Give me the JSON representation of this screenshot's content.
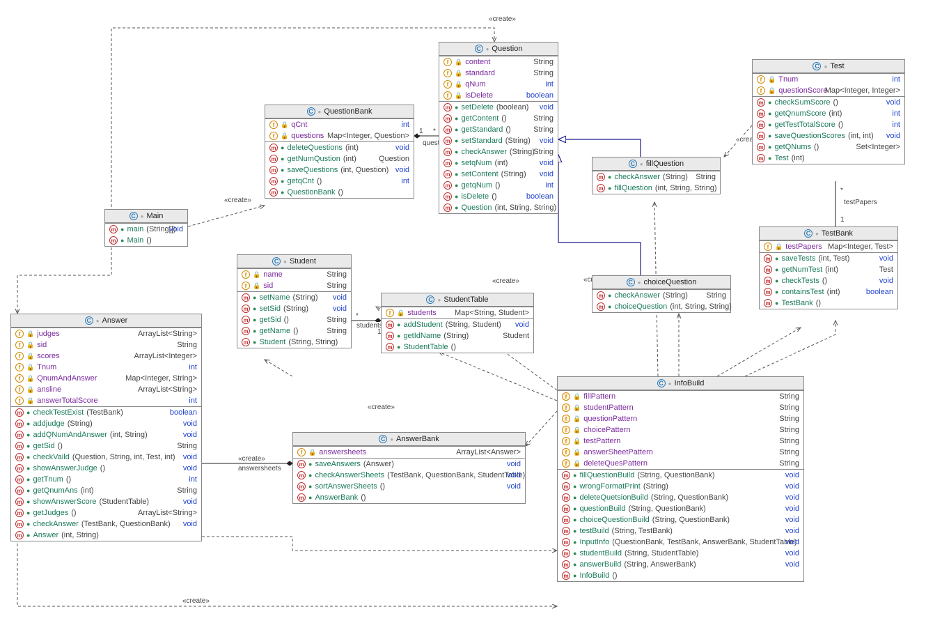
{
  "classes": {
    "Question": {
      "title": "Question",
      "fields": [
        {
          "badge": "f",
          "vis": "lock",
          "name": "content",
          "type": "String",
          "typeColor": "plain"
        },
        {
          "badge": "f",
          "vis": "lock",
          "name": "standard",
          "type": "String",
          "typeColor": "plain"
        },
        {
          "badge": "f",
          "vis": "lock",
          "name": "qNum",
          "type": "int",
          "typeColor": "blue"
        },
        {
          "badge": "f",
          "vis": "lock",
          "name": "isDelete",
          "type": "boolean",
          "typeColor": "blue"
        }
      ],
      "methods": [
        {
          "badge": "m",
          "vis": "green",
          "name": "setDelete",
          "params": "(boolean)",
          "type": "void",
          "typeColor": "blue"
        },
        {
          "badge": "m",
          "vis": "green",
          "name": "getContent",
          "params": "()",
          "type": "String",
          "typeColor": "plain"
        },
        {
          "badge": "m",
          "vis": "green",
          "name": "getStandard",
          "params": "()",
          "type": "String",
          "typeColor": "plain"
        },
        {
          "badge": "m",
          "vis": "green",
          "name": "setStandard",
          "params": "(String)",
          "type": "void",
          "typeColor": "blue"
        },
        {
          "badge": "m",
          "vis": "green",
          "name": "checkAnswer",
          "params": "(String)",
          "type": "String",
          "typeColor": "plain"
        },
        {
          "badge": "m",
          "vis": "green",
          "name": "setqNum",
          "params": "(int)",
          "type": "void",
          "typeColor": "blue"
        },
        {
          "badge": "m",
          "vis": "green",
          "name": "setContent",
          "params": "(String)",
          "type": "void",
          "typeColor": "blue"
        },
        {
          "badge": "m",
          "vis": "green",
          "name": "getqNum",
          "params": "()",
          "type": "int",
          "typeColor": "blue"
        },
        {
          "badge": "m",
          "vis": "green",
          "name": "isDelete",
          "params": "()",
          "type": "boolean",
          "typeColor": "blue"
        },
        {
          "badge": "m",
          "vis": "green",
          "name": "Question",
          "params": "(int, String, String)",
          "type": "",
          "typeColor": ""
        }
      ]
    },
    "Test": {
      "title": "Test",
      "fields": [
        {
          "badge": "f",
          "vis": "lock",
          "name": "Tnum",
          "type": "int",
          "typeColor": "blue"
        },
        {
          "badge": "f",
          "vis": "lock",
          "name": "questionScore",
          "type": "Map<Integer, Integer>",
          "typeColor": "plain"
        }
      ],
      "methods": [
        {
          "badge": "m",
          "vis": "green",
          "name": "checkSumScore",
          "params": "()",
          "type": "void",
          "typeColor": "blue"
        },
        {
          "badge": "m",
          "vis": "green",
          "name": "getQnumScore",
          "params": "(int)",
          "type": "int",
          "typeColor": "blue"
        },
        {
          "badge": "m",
          "vis": "green",
          "name": "getTestTotalScore",
          "params": "()",
          "type": "int",
          "typeColor": "blue"
        },
        {
          "badge": "m",
          "vis": "green",
          "name": "saveQuestionScores",
          "params": "(int, int)",
          "type": "void",
          "typeColor": "blue"
        },
        {
          "badge": "m",
          "vis": "green",
          "name": "getQNums",
          "params": "()",
          "type": "Set<Integer>",
          "typeColor": "plain"
        },
        {
          "badge": "m",
          "vis": "green",
          "name": "Test",
          "params": "(int)",
          "type": "",
          "typeColor": ""
        }
      ]
    },
    "QuestionBank": {
      "title": "QuestionBank",
      "fields": [
        {
          "badge": "f",
          "vis": "lock",
          "name": "qCnt",
          "type": "int",
          "typeColor": "blue"
        },
        {
          "badge": "f",
          "vis": "lock",
          "name": "questions",
          "type": "Map<Integer, Question>",
          "typeColor": "plain"
        }
      ],
      "methods": [
        {
          "badge": "m",
          "vis": "green",
          "name": "deleteQuestions",
          "params": "(int)",
          "type": "void",
          "typeColor": "blue"
        },
        {
          "badge": "m",
          "vis": "green",
          "name": "getNumQustion",
          "params": "(int)",
          "type": "Question",
          "typeColor": "plain"
        },
        {
          "badge": "m",
          "vis": "green",
          "name": "saveQuestions",
          "params": "(int, Question)",
          "type": "void",
          "typeColor": "blue"
        },
        {
          "badge": "m",
          "vis": "green",
          "name": "getqCnt",
          "params": "()",
          "type": "int",
          "typeColor": "blue"
        },
        {
          "badge": "m",
          "vis": "green",
          "name": "QuestionBank",
          "params": "()",
          "type": "",
          "typeColor": ""
        }
      ]
    },
    "fillQuestion": {
      "title": "fillQuestion",
      "fields": [],
      "methods": [
        {
          "badge": "m",
          "vis": "green",
          "name": "checkAnswer",
          "params": "(String)",
          "type": "String",
          "typeColor": "plain"
        },
        {
          "badge": "m",
          "vis": "green",
          "name": "fillQuestion",
          "params": "(int, String, String)",
          "type": "",
          "typeColor": ""
        }
      ]
    },
    "choiceQuestion": {
      "title": "choiceQuestion",
      "fields": [],
      "methods": [
        {
          "badge": "m",
          "vis": "green",
          "name": "checkAnswer",
          "params": "(String)",
          "type": "String",
          "typeColor": "plain"
        },
        {
          "badge": "m",
          "vis": "green",
          "name": "choiceQuestion",
          "params": "(int, String, String)",
          "type": "",
          "typeColor": ""
        }
      ]
    },
    "TestBank": {
      "title": "TestBank",
      "fields": [
        {
          "badge": "f",
          "vis": "lock",
          "name": "testPapers",
          "type": "Map<Integer, Test>",
          "typeColor": "plain"
        }
      ],
      "methods": [
        {
          "badge": "m",
          "vis": "green",
          "name": "saveTests",
          "params": "(int, Test)",
          "type": "void",
          "typeColor": "blue"
        },
        {
          "badge": "m",
          "vis": "green",
          "name": "getNumTest",
          "params": "(int)",
          "type": "Test",
          "typeColor": "plain"
        },
        {
          "badge": "m",
          "vis": "green",
          "name": "checkTests",
          "params": "()",
          "type": "void",
          "typeColor": "blue"
        },
        {
          "badge": "m",
          "vis": "green",
          "name": "containsTest",
          "params": "(int)",
          "type": "boolean",
          "typeColor": "blue"
        },
        {
          "badge": "m",
          "vis": "green",
          "name": "TestBank",
          "params": "()",
          "type": "",
          "typeColor": ""
        }
      ]
    },
    "Main": {
      "title": "Main",
      "fields": [],
      "methods": [
        {
          "badge": "m",
          "vis": "green",
          "name": "main",
          "params": "(String[])",
          "type": "void",
          "typeColor": "blue",
          "static": true
        },
        {
          "badge": "m",
          "vis": "green",
          "name": "Main",
          "params": "()",
          "type": "",
          "typeColor": ""
        }
      ]
    },
    "Student": {
      "title": "Student",
      "fields": [
        {
          "badge": "f",
          "vis": "lock",
          "name": "name",
          "type": "String",
          "typeColor": "plain"
        },
        {
          "badge": "f",
          "vis": "lock",
          "name": "sid",
          "type": "String",
          "typeColor": "plain"
        }
      ],
      "methods": [
        {
          "badge": "m",
          "vis": "green",
          "name": "setName",
          "params": "(String)",
          "type": "void",
          "typeColor": "blue"
        },
        {
          "badge": "m",
          "vis": "green",
          "name": "setSid",
          "params": "(String)",
          "type": "void",
          "typeColor": "blue"
        },
        {
          "badge": "m",
          "vis": "green",
          "name": "getSid",
          "params": "()",
          "type": "String",
          "typeColor": "plain"
        },
        {
          "badge": "m",
          "vis": "green",
          "name": "getName",
          "params": "()",
          "type": "String",
          "typeColor": "plain"
        },
        {
          "badge": "m",
          "vis": "green",
          "name": "Student",
          "params": "(String, String)",
          "type": "",
          "typeColor": ""
        }
      ]
    },
    "StudentTable": {
      "title": "StudentTable",
      "fields": [
        {
          "badge": "f",
          "vis": "lock",
          "name": "students",
          "type": "Map<String, Student>",
          "typeColor": "plain"
        }
      ],
      "methods": [
        {
          "badge": "m",
          "vis": "green",
          "name": "addStudent",
          "params": "(String, Student)",
          "type": "void",
          "typeColor": "blue"
        },
        {
          "badge": "m",
          "vis": "green",
          "name": "getIdName",
          "params": "(String)",
          "type": "Student",
          "typeColor": "plain"
        },
        {
          "badge": "m",
          "vis": "green",
          "name": "StudentTable",
          "params": "()",
          "type": "",
          "typeColor": ""
        }
      ]
    },
    "Answer": {
      "title": "Answer",
      "fields": [
        {
          "badge": "f",
          "vis": "lock",
          "name": "judges",
          "type": "ArrayList<String>",
          "typeColor": "plain"
        },
        {
          "badge": "f",
          "vis": "lock",
          "name": "sid",
          "type": "String",
          "typeColor": "plain"
        },
        {
          "badge": "f",
          "vis": "lock",
          "name": "scores",
          "type": "ArrayList<Integer>",
          "typeColor": "plain"
        },
        {
          "badge": "f",
          "vis": "lock",
          "name": "Tnum",
          "type": "int",
          "typeColor": "blue"
        },
        {
          "badge": "f",
          "vis": "lock",
          "name": "QnumAndAnswer",
          "type": "Map<Integer, String>",
          "typeColor": "plain"
        },
        {
          "badge": "f",
          "vis": "lock",
          "name": "ansline",
          "type": "ArrayList<String>",
          "typeColor": "plain"
        },
        {
          "badge": "f",
          "vis": "lock",
          "name": "answerTotalScore",
          "type": "int",
          "typeColor": "blue"
        }
      ],
      "methods": [
        {
          "badge": "m",
          "vis": "green",
          "name": "checkTestExist",
          "params": "(TestBank)",
          "type": "boolean",
          "typeColor": "blue"
        },
        {
          "badge": "m",
          "vis": "green",
          "name": "addjudge",
          "params": "(String)",
          "type": "void",
          "typeColor": "blue"
        },
        {
          "badge": "m",
          "vis": "green",
          "name": "addQNumAndAnswer",
          "params": "(int, String)",
          "type": "void",
          "typeColor": "blue"
        },
        {
          "badge": "m",
          "vis": "green",
          "name": "getSid",
          "params": "()",
          "type": "String",
          "typeColor": "plain"
        },
        {
          "badge": "m",
          "vis": "green",
          "name": "checkVaild",
          "params": "(Question, String, int, Test, int)",
          "type": "void",
          "typeColor": "blue"
        },
        {
          "badge": "m",
          "vis": "green",
          "name": "showAnswerJudge",
          "params": "()",
          "type": "void",
          "typeColor": "blue"
        },
        {
          "badge": "m",
          "vis": "green",
          "name": "getTnum",
          "params": "()",
          "type": "int",
          "typeColor": "blue"
        },
        {
          "badge": "m",
          "vis": "green",
          "name": "getQnumAns",
          "params": "(int)",
          "type": "String",
          "typeColor": "plain"
        },
        {
          "badge": "m",
          "vis": "green",
          "name": "showAnswerScore",
          "params": "(StudentTable)",
          "type": "void",
          "typeColor": "blue"
        },
        {
          "badge": "m",
          "vis": "green",
          "name": "getJudges",
          "params": "()",
          "type": "ArrayList<String>",
          "typeColor": "plain"
        },
        {
          "badge": "m",
          "vis": "green",
          "name": "checkAnswer",
          "params": "(TestBank, QuestionBank)",
          "type": "void",
          "typeColor": "blue"
        },
        {
          "badge": "m",
          "vis": "green",
          "name": "Answer",
          "params": "(int, String)",
          "type": "",
          "typeColor": ""
        }
      ]
    },
    "AnswerBank": {
      "title": "AnswerBank",
      "fields": [
        {
          "badge": "f",
          "vis": "lock",
          "name": "answersheets",
          "type": "ArrayList<Answer>",
          "typeColor": "plain"
        }
      ],
      "methods": [
        {
          "badge": "m",
          "vis": "green",
          "name": "saveAnswers",
          "params": "(Answer)",
          "type": "void",
          "typeColor": "blue"
        },
        {
          "badge": "m",
          "vis": "green",
          "name": "checkAnswerSheets",
          "params": "(TestBank, QuestionBank, StudentTable)",
          "type": "void",
          "typeColor": "blue"
        },
        {
          "badge": "m",
          "vis": "green",
          "name": "sortAnswerSheets",
          "params": "()",
          "type": "void",
          "typeColor": "blue"
        },
        {
          "badge": "m",
          "vis": "green",
          "name": "AnswerBank",
          "params": "()",
          "type": "",
          "typeColor": ""
        }
      ]
    },
    "InfoBuild": {
      "title": "InfoBuild",
      "fields": [
        {
          "badge": "sf",
          "vis": "lock",
          "name": "fillPattern",
          "type": "String",
          "typeColor": "plain"
        },
        {
          "badge": "sf",
          "vis": "lock",
          "name": "studentPattern",
          "type": "String",
          "typeColor": "plain"
        },
        {
          "badge": "sf",
          "vis": "lock",
          "name": "questionPattern",
          "type": "String",
          "typeColor": "plain"
        },
        {
          "badge": "sf",
          "vis": "lock",
          "name": "choicePattern",
          "type": "String",
          "typeColor": "plain"
        },
        {
          "badge": "sf",
          "vis": "lock",
          "name": "testPattern",
          "type": "String",
          "typeColor": "plain"
        },
        {
          "badge": "sf",
          "vis": "lock",
          "name": "answerSheetPattern",
          "type": "String",
          "typeColor": "plain"
        },
        {
          "badge": "sf",
          "vis": "lock",
          "name": "deleteQuesPattern",
          "type": "String",
          "typeColor": "plain"
        }
      ],
      "methods": [
        {
          "badge": "m",
          "vis": "green",
          "name": "fillQuestionBuild",
          "params": "(String, QuestionBank)",
          "type": "void",
          "typeColor": "blue"
        },
        {
          "badge": "m",
          "vis": "green",
          "name": "wrongFormatPrint",
          "params": "(String)",
          "type": "void",
          "typeColor": "blue"
        },
        {
          "badge": "m",
          "vis": "green",
          "name": "deleteQuetsionBuild",
          "params": "(String, QuestionBank)",
          "type": "void",
          "typeColor": "blue"
        },
        {
          "badge": "m",
          "vis": "green",
          "name": "questionBuild",
          "params": "(String, QuestionBank)",
          "type": "void",
          "typeColor": "blue"
        },
        {
          "badge": "m",
          "vis": "green",
          "name": "choiceQuestionBuild",
          "params": "(String, QuestionBank)",
          "type": "void",
          "typeColor": "blue"
        },
        {
          "badge": "m",
          "vis": "green",
          "name": "testBuild",
          "params": "(String, TestBank)",
          "type": "void",
          "typeColor": "blue"
        },
        {
          "badge": "m",
          "vis": "green",
          "name": "InputInfo",
          "params": "(QuestionBank, TestBank, AnswerBank, StudentTable)",
          "type": "void",
          "typeColor": "blue"
        },
        {
          "badge": "m",
          "vis": "green",
          "name": "studentBuild",
          "params": "(String, StudentTable)",
          "type": "void",
          "typeColor": "blue"
        },
        {
          "badge": "m",
          "vis": "green",
          "name": "answerBuild",
          "params": "(String, AnswerBank)",
          "type": "void",
          "typeColor": "blue"
        },
        {
          "badge": "m",
          "vis": "green",
          "name": "InfoBuild",
          "params": "()",
          "type": "",
          "typeColor": ""
        }
      ]
    }
  },
  "labels": {
    "create": "«create»",
    "questions": "questions",
    "students": "students",
    "one": "1",
    "star": "*",
    "testPapers": "testPapers",
    "answersheets": "answersheets"
  }
}
